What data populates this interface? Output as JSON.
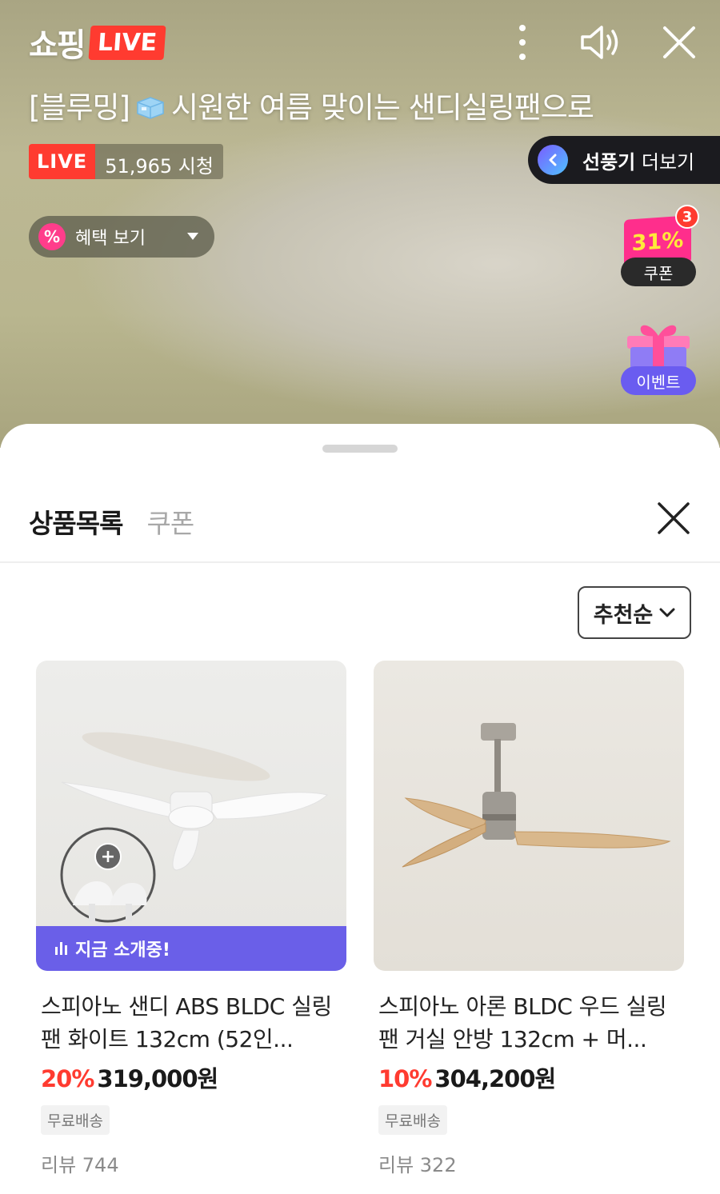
{
  "live": {
    "brand_text": "쇼핑",
    "brand_live": "LIVE",
    "title": "[블루밍] 시원한 여름 맞이는 샌디실링팬으로",
    "title_prefix": "[블루밍]",
    "title_rest": "시원한 여름 맞이는 샌디실링팬으로",
    "badge_live": "LIVE",
    "viewer_count": "51,965 시청",
    "more_bold": "선풍기",
    "more_rest": " 더보기",
    "benefit_label": "혜택 보기",
    "benefit_icon": "%",
    "coupon_percent": "31%",
    "coupon_count": "3",
    "coupon_label": "쿠폰",
    "event_label": "이벤트"
  },
  "sheet": {
    "tabs": [
      {
        "label": "상품목록",
        "active": true
      },
      {
        "label": "쿠폰",
        "active": false
      }
    ],
    "sort_label": "추천순"
  },
  "products": [
    {
      "name": "스피아노 샌디 ABS BLDC 실링팬 화이트 132cm (52인...",
      "discount": "20%",
      "price": "319,000원",
      "shipping": "무료배송",
      "reviews": "리뷰 744",
      "now_showing": "지금 소개중!",
      "addon_icon": "+"
    },
    {
      "name": "스피아노 아론 BLDC 우드 실링팬 거실 안방 132cm + 머...",
      "discount": "10%",
      "price": "304,200원",
      "shipping": "무료배송",
      "reviews": "리뷰 322"
    }
  ],
  "colors": {
    "live_red": "#ff3b30",
    "discount_red": "#ff3b30",
    "now_showing_purple": "#6a5fe8",
    "coupon_pink": "#ff2e8c"
  },
  "icons": [
    "more-vertical-icon",
    "speaker-icon",
    "close-icon",
    "chevron-left-icon",
    "percent-icon",
    "caret-down-icon",
    "gift-icon",
    "chevron-down-icon",
    "equalizer-icon",
    "plus-icon",
    "ice-cube-icon"
  ]
}
